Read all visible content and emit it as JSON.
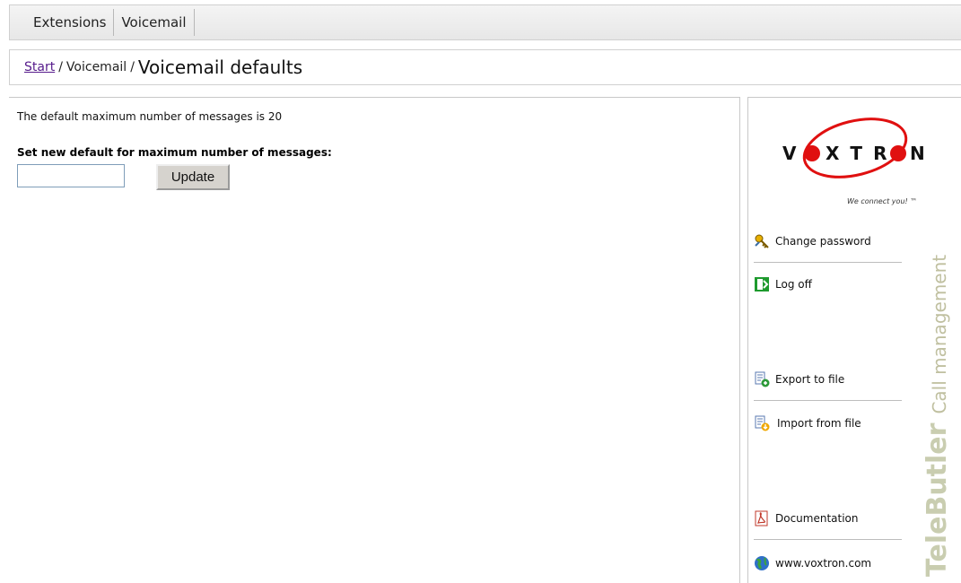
{
  "tabs": [
    {
      "label": "Extensions"
    },
    {
      "label": "Voicemail"
    }
  ],
  "breadcrumb": {
    "start": "Start",
    "section": "Voicemail",
    "title": "Voicemail defaults",
    "separator": "/"
  },
  "main": {
    "info_text": "The default maximum number of messages is 20",
    "field_label": "Set new default for maximum number of messages:",
    "input_value": "",
    "update_label": "Update"
  },
  "sidebar": {
    "logo_text_left": "V",
    "logo_text_mid": "XTR",
    "logo_text_right": "N",
    "tagline": "We connect you! ™",
    "items": [
      {
        "label": "Change password",
        "icon": "key-icon"
      },
      {
        "label": "Log off",
        "icon": "exit-icon"
      },
      {
        "label": "Export to file",
        "icon": "export-icon"
      },
      {
        "label": "Import from file",
        "icon": "import-icon"
      },
      {
        "label": "Documentation",
        "icon": "pdf-icon"
      },
      {
        "label": "www.voxtron.com",
        "icon": "globe-icon"
      }
    ],
    "vertical_brand": "TeleButler",
    "vertical_sub": "Call management"
  },
  "colors": {
    "logo_red": "#e01010",
    "link_purple": "#551a8b",
    "brand_watermark": "#c9cdb0"
  }
}
